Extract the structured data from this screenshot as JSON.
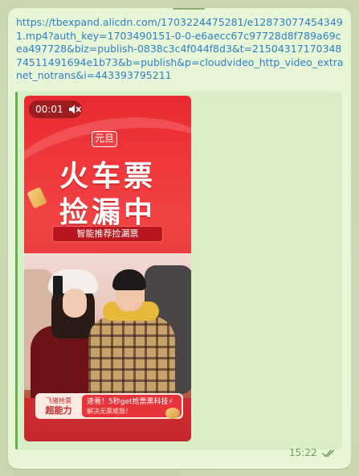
{
  "message": {
    "link_text": "https://tbexpand.alicdn.com/1703224475281/e128730774543491.mp4?auth_key=1703490151-0-0-e6aecc67c97728d8f789a69cea497728&biz=publish-0838c3c4f044f8d3&t=2150431717034874511491694e1b73&b=publish&p=cloudvideo_http_video_extranet_notrans&i=443393795211",
    "time": "15:22",
    "status_icon": "double-check-icon"
  },
  "video": {
    "timestamp": "00:01",
    "mute_icon": "muted-speaker-icon",
    "tag": "元旦",
    "headline_line1": "火车票",
    "headline_line2": "捡漏中",
    "sub_banner": "智能推荐捡漏票",
    "bottom_banner": {
      "left_small": "飞猪抢票",
      "left_big": "超能力",
      "right_line1": "速看！5秒get抢票黑科技⚡",
      "right_line2": "解决无票难题！"
    }
  },
  "colors": {
    "bubble": "#e7f6d6",
    "link": "#2e7fc6",
    "quote_bar": "#5fb34a",
    "video_red": "#e82a31",
    "time": "#6f9c5a"
  }
}
